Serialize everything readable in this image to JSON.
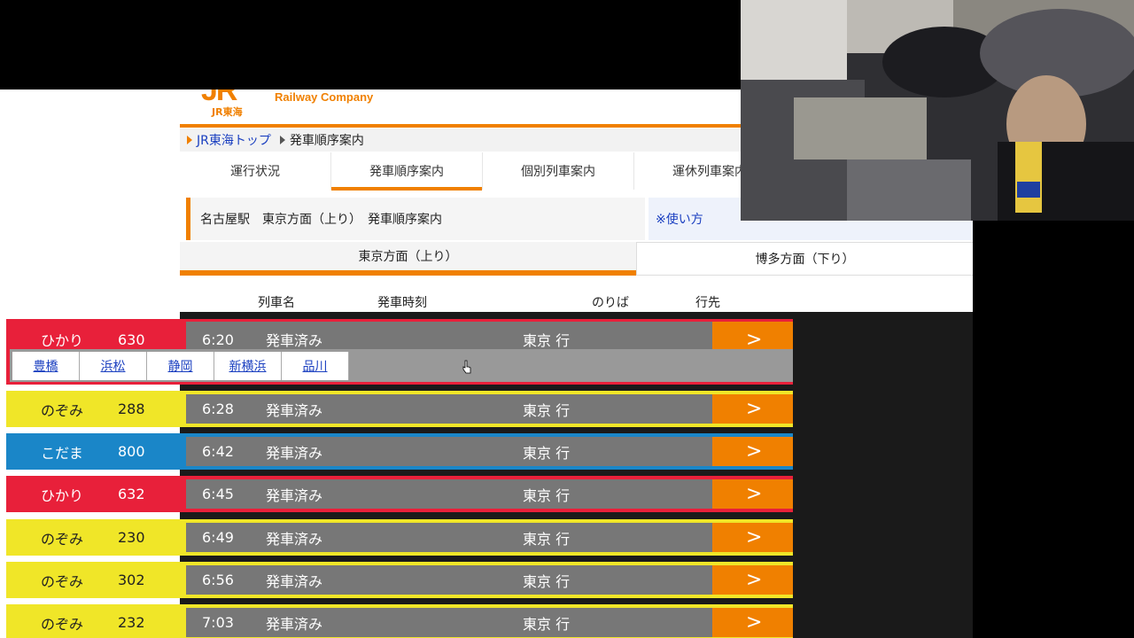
{
  "header": {
    "logo_mark": "JR",
    "logo_sub": "JR東海",
    "company": "Railway Company"
  },
  "breadcrumb": {
    "home": "JR東海トップ",
    "current": "発車順序案内"
  },
  "tabs": [
    {
      "label": "運行状況"
    },
    {
      "label": "発車順序案内"
    },
    {
      "label": "個別列車案内"
    },
    {
      "label": "運休列車案内"
    }
  ],
  "title": "名古屋駅　東京方面（上り）　発車順序案内",
  "howto": "※使い方",
  "directions": {
    "up": "東京方面（上り）",
    "down": "博多方面（下り）"
  },
  "columns": {
    "train": "列車名",
    "time": "発車時刻",
    "platform": "のりば",
    "destination": "行先"
  },
  "trains": [
    {
      "type": "ひかり",
      "number": "630",
      "time": "6:20",
      "status": "発車済み",
      "dest": "東京 行",
      "arrow": ">"
    },
    {
      "type": "のぞみ",
      "number": "288",
      "time": "6:28",
      "status": "発車済み",
      "dest": "東京 行",
      "arrow": ">"
    },
    {
      "type": "こだま",
      "number": "800",
      "time": "6:42",
      "status": "発車済み",
      "dest": "東京 行",
      "arrow": ">"
    },
    {
      "type": "ひかり",
      "number": "632",
      "time": "6:45",
      "status": "発車済み",
      "dest": "東京 行",
      "arrow": ">"
    },
    {
      "type": "のぞみ",
      "number": "230",
      "time": "6:49",
      "status": "発車済み",
      "dest": "東京 行",
      "arrow": ">"
    },
    {
      "type": "のぞみ",
      "number": "302",
      "time": "6:56",
      "status": "発車済み",
      "dest": "東京 行",
      "arrow": ">"
    },
    {
      "type": "のぞみ",
      "number": "232",
      "time": "7:03",
      "status": "発車済み",
      "dest": "東京 行",
      "arrow": ">"
    }
  ],
  "stops": [
    "豊橋",
    "浜松",
    "静岡",
    "新横浜",
    "品川"
  ],
  "colors": {
    "accent": "#f08000",
    "hikari": "#e8203a",
    "nozomi": "#f0e628",
    "kodama": "#1a86c8",
    "row_gray": "#777777"
  }
}
